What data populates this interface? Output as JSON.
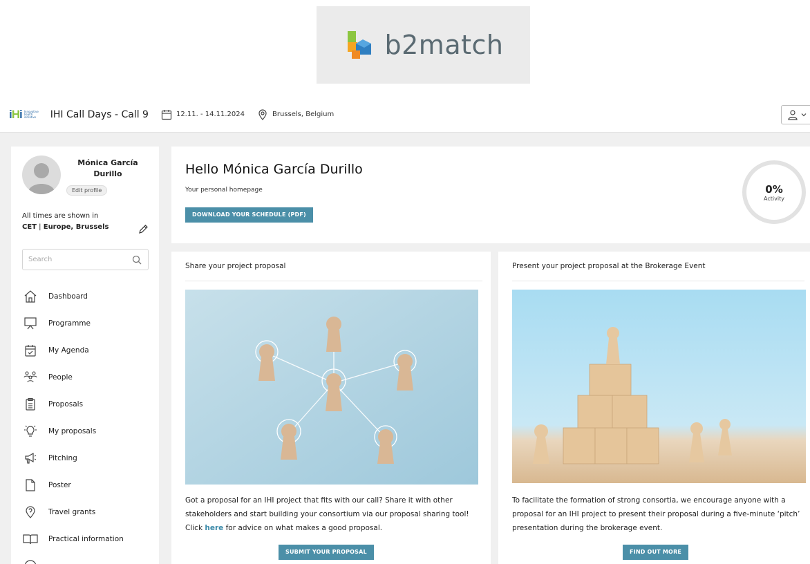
{
  "logo": {
    "brand_text": "b2match"
  },
  "topbar": {
    "event_title": "IHI Call Days - Call 9",
    "dates": "12.11. - 14.11.2024",
    "location": "Brussels, Belgium",
    "ihi_logo_text": "Innovative health initiative"
  },
  "profile": {
    "name": "Mónica García Durillo",
    "edit_label": "Edit profile"
  },
  "timezone": {
    "prefix": "All times are shown in",
    "zone": "CET",
    "separator": " | ",
    "city": "Europe, Brussels"
  },
  "search": {
    "placeholder": "Search"
  },
  "nav": {
    "items": [
      {
        "label": "Dashboard",
        "icon": "home-icon"
      },
      {
        "label": "Programme",
        "icon": "presentation-icon"
      },
      {
        "label": "My Agenda",
        "icon": "calendar-check-icon"
      },
      {
        "label": "People",
        "icon": "people-icon"
      },
      {
        "label": "Proposals",
        "icon": "clipboard-list-icon"
      },
      {
        "label": "My proposals",
        "icon": "lightbulb-icon"
      },
      {
        "label": "Pitching",
        "icon": "megaphone-icon"
      },
      {
        "label": "Poster",
        "icon": "document-icon"
      },
      {
        "label": "Travel grants",
        "icon": "map-pin-icon"
      },
      {
        "label": "Practical information",
        "icon": "book-icon"
      }
    ]
  },
  "hello": {
    "title": "Hello Mónica García Durillo",
    "subtitle": "Your personal homepage",
    "download_label": "DOWNLOAD YOUR SCHEDULE (PDF)",
    "activity_value": "0%",
    "activity_label": "Activity",
    "activity_fraction": 0
  },
  "cards": {
    "left": {
      "title": "Share your project proposal",
      "text_before": "Got a proposal for an IHI project that fits with our call? Share it with other stakeholders and start building your consortium via our proposal sharing tool! Click ",
      "link": "here",
      "text_after": " for advice on what makes a good proposal.",
      "button": "SUBMIT YOUR PROPOSAL"
    },
    "right": {
      "title": "Present your project proposal at the Brokerage Event",
      "text": "To facilitate the formation of strong consortia, we encourage anyone with a proposal for an IHI project to present their proposal during a five-minute ‘pitch’ presentation during the brokerage event.",
      "button": "FIND OUT MORE"
    }
  },
  "colors": {
    "accent": "#4b8fa8",
    "ihi_green": "#8cc640",
    "ihi_blue": "#2b6aa6"
  }
}
